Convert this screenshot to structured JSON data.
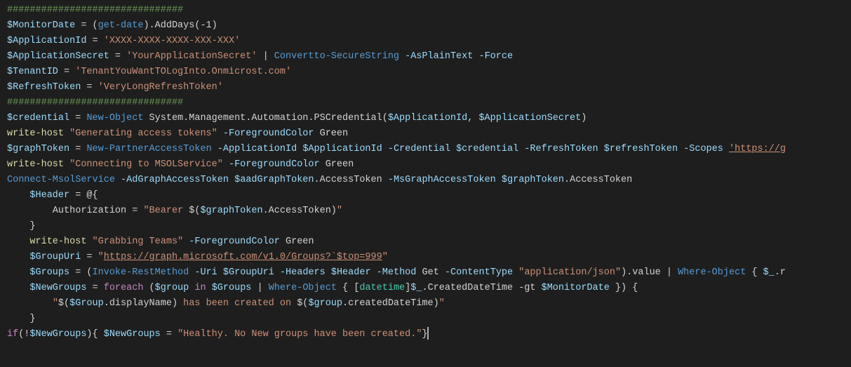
{
  "lines": [
    {
      "indent": 0,
      "tokens": [
        {
          "cls": "c-comment",
          "t": "###############################"
        }
      ]
    },
    {
      "indent": 0,
      "tokens": [
        {
          "cls": "c-var",
          "t": "$MonitorDate"
        },
        {
          "cls": "c-op",
          "t": " = ("
        },
        {
          "cls": "c-cmd",
          "t": "get-date"
        },
        {
          "cls": "c-op",
          "t": ").AddDays("
        },
        {
          "cls": "c-default",
          "t": "-1"
        },
        {
          "cls": "c-op",
          "t": ")"
        }
      ]
    },
    {
      "indent": 0,
      "tokens": [
        {
          "cls": "c-var",
          "t": "$ApplicationId"
        },
        {
          "cls": "c-op",
          "t": " = "
        },
        {
          "cls": "c-string",
          "t": "'XXXX-XXXX-XXXX-XXX-XXX'"
        }
      ]
    },
    {
      "indent": 0,
      "tokens": [
        {
          "cls": "c-var",
          "t": "$ApplicationSecret"
        },
        {
          "cls": "c-op",
          "t": " = "
        },
        {
          "cls": "c-string",
          "t": "'YourApplicationSecret'"
        },
        {
          "cls": "c-op",
          "t": " | "
        },
        {
          "cls": "c-cmd",
          "t": "Convertto-SecureString"
        },
        {
          "cls": "c-op",
          "t": " "
        },
        {
          "cls": "c-param",
          "t": "-AsPlainText"
        },
        {
          "cls": "c-op",
          "t": " "
        },
        {
          "cls": "c-param",
          "t": "-Force"
        }
      ]
    },
    {
      "indent": 0,
      "tokens": [
        {
          "cls": "c-var",
          "t": "$TenantID"
        },
        {
          "cls": "c-op",
          "t": " = "
        },
        {
          "cls": "c-string",
          "t": "'TenantYouWantTOLogInto.Onmicrost.com'"
        }
      ]
    },
    {
      "indent": 0,
      "tokens": [
        {
          "cls": "c-var",
          "t": "$RefreshToken"
        },
        {
          "cls": "c-op",
          "t": " = "
        },
        {
          "cls": "c-string",
          "t": "'VeryLongRefreshToken'"
        }
      ]
    },
    {
      "indent": 0,
      "tokens": [
        {
          "cls": "c-comment",
          "t": "###############################"
        }
      ]
    },
    {
      "indent": 0,
      "tokens": [
        {
          "cls": "c-var",
          "t": "$credential"
        },
        {
          "cls": "c-op",
          "t": " = "
        },
        {
          "cls": "c-cmd",
          "t": "New-Object"
        },
        {
          "cls": "c-op",
          "t": " System.Management.Automation.PSCredential("
        },
        {
          "cls": "c-var",
          "t": "$ApplicationId"
        },
        {
          "cls": "c-op",
          "t": ", "
        },
        {
          "cls": "c-var",
          "t": "$ApplicationSecret"
        },
        {
          "cls": "c-op",
          "t": ")"
        }
      ]
    },
    {
      "indent": 0,
      "tokens": [
        {
          "cls": "c-cmdlet",
          "t": "write-host"
        },
        {
          "cls": "c-op",
          "t": " "
        },
        {
          "cls": "c-string",
          "t": "\"Generating access tokens\""
        },
        {
          "cls": "c-op",
          "t": " "
        },
        {
          "cls": "c-param",
          "t": "-ForegroundColor"
        },
        {
          "cls": "c-op",
          "t": " Green"
        }
      ]
    },
    {
      "indent": 0,
      "tokens": [
        {
          "cls": "c-var",
          "t": "$graphToken"
        },
        {
          "cls": "c-op",
          "t": " = "
        },
        {
          "cls": "c-cmd",
          "t": "New-PartnerAccessToken"
        },
        {
          "cls": "c-op",
          "t": " "
        },
        {
          "cls": "c-param",
          "t": "-ApplicationId"
        },
        {
          "cls": "c-op",
          "t": " "
        },
        {
          "cls": "c-var",
          "t": "$ApplicationId"
        },
        {
          "cls": "c-op",
          "t": " "
        },
        {
          "cls": "c-param",
          "t": "-Credential"
        },
        {
          "cls": "c-op",
          "t": " "
        },
        {
          "cls": "c-var",
          "t": "$credential"
        },
        {
          "cls": "c-op",
          "t": " "
        },
        {
          "cls": "c-param",
          "t": "-RefreshToken"
        },
        {
          "cls": "c-op",
          "t": " "
        },
        {
          "cls": "c-var",
          "t": "$refreshToken"
        },
        {
          "cls": "c-op",
          "t": " "
        },
        {
          "cls": "c-param",
          "t": "-Scopes"
        },
        {
          "cls": "c-op",
          "t": " "
        },
        {
          "cls": "c-string-u",
          "t": "'https://g"
        }
      ]
    },
    {
      "indent": 0,
      "tokens": [
        {
          "cls": "c-cmdlet",
          "t": "write-host"
        },
        {
          "cls": "c-op",
          "t": " "
        },
        {
          "cls": "c-string",
          "t": "\"Connecting to MSOLService\""
        },
        {
          "cls": "c-op",
          "t": " "
        },
        {
          "cls": "c-param",
          "t": "-ForegroundColor"
        },
        {
          "cls": "c-op",
          "t": " Green"
        }
      ]
    },
    {
      "indent": 0,
      "tokens": [
        {
          "cls": "c-cmd",
          "t": "Connect-MsolService"
        },
        {
          "cls": "c-op",
          "t": " "
        },
        {
          "cls": "c-param",
          "t": "-AdGraphAccessToken"
        },
        {
          "cls": "c-op",
          "t": " "
        },
        {
          "cls": "c-var",
          "t": "$aadGraphToken"
        },
        {
          "cls": "c-op",
          "t": ".AccessToken "
        },
        {
          "cls": "c-param",
          "t": "-MsGraphAccessToken"
        },
        {
          "cls": "c-op",
          "t": " "
        },
        {
          "cls": "c-var",
          "t": "$graphToken"
        },
        {
          "cls": "c-op",
          "t": ".AccessToken"
        }
      ]
    },
    {
      "indent": 1,
      "tokens": [
        {
          "cls": "c-var",
          "t": "$Header"
        },
        {
          "cls": "c-op",
          "t": " = @{"
        }
      ]
    },
    {
      "indent": 2,
      "tokens": [
        {
          "cls": "c-default",
          "t": "Authorization = "
        },
        {
          "cls": "c-string",
          "t": "\"Bearer "
        },
        {
          "cls": "c-op",
          "t": "$("
        },
        {
          "cls": "c-var",
          "t": "$graphToken"
        },
        {
          "cls": "c-op",
          "t": ".AccessToken)"
        },
        {
          "cls": "c-string",
          "t": "\""
        }
      ]
    },
    {
      "indent": 1,
      "tokens": [
        {
          "cls": "c-op",
          "t": "}"
        }
      ]
    },
    {
      "indent": 1,
      "tokens": [
        {
          "cls": "c-cmdlet",
          "t": "write-host"
        },
        {
          "cls": "c-op",
          "t": " "
        },
        {
          "cls": "c-string",
          "t": "\"Grabbing Teams\""
        },
        {
          "cls": "c-op",
          "t": " "
        },
        {
          "cls": "c-param",
          "t": "-ForegroundColor"
        },
        {
          "cls": "c-op",
          "t": " Green"
        }
      ]
    },
    {
      "indent": 1,
      "tokens": [
        {
          "cls": "c-var",
          "t": "$GroupUri"
        },
        {
          "cls": "c-op",
          "t": " = "
        },
        {
          "cls": "c-string",
          "t": "\""
        },
        {
          "cls": "c-string-u",
          "t": "https://graph.microsoft.com/v1.0/Groups?`$top=999"
        },
        {
          "cls": "c-string",
          "t": "\""
        }
      ]
    },
    {
      "indent": 1,
      "tokens": [
        {
          "cls": "c-var",
          "t": "$Groups"
        },
        {
          "cls": "c-op",
          "t": " = ("
        },
        {
          "cls": "c-cmd",
          "t": "Invoke-RestMethod"
        },
        {
          "cls": "c-op",
          "t": " "
        },
        {
          "cls": "c-param",
          "t": "-Uri"
        },
        {
          "cls": "c-op",
          "t": " "
        },
        {
          "cls": "c-var",
          "t": "$GroupUri"
        },
        {
          "cls": "c-op",
          "t": " "
        },
        {
          "cls": "c-param",
          "t": "-Headers"
        },
        {
          "cls": "c-op",
          "t": " "
        },
        {
          "cls": "c-var",
          "t": "$Header"
        },
        {
          "cls": "c-op",
          "t": " "
        },
        {
          "cls": "c-param",
          "t": "-Method"
        },
        {
          "cls": "c-op",
          "t": " Get "
        },
        {
          "cls": "c-param",
          "t": "-ContentType"
        },
        {
          "cls": "c-op",
          "t": " "
        },
        {
          "cls": "c-string",
          "t": "\"application/json\""
        },
        {
          "cls": "c-op",
          "t": ").value | "
        },
        {
          "cls": "c-cmd",
          "t": "Where-Object"
        },
        {
          "cls": "c-op",
          "t": " { "
        },
        {
          "cls": "c-var",
          "t": "$_"
        },
        {
          "cls": "c-op",
          "t": ".r"
        }
      ]
    },
    {
      "indent": 1,
      "tokens": [
        {
          "cls": "c-var",
          "t": "$NewGroups"
        },
        {
          "cls": "c-op",
          "t": " = "
        },
        {
          "cls": "c-kw",
          "t": "foreach"
        },
        {
          "cls": "c-op",
          "t": " ("
        },
        {
          "cls": "c-var",
          "t": "$group"
        },
        {
          "cls": "c-op",
          "t": " "
        },
        {
          "cls": "c-kw",
          "t": "in"
        },
        {
          "cls": "c-op",
          "t": " "
        },
        {
          "cls": "c-var",
          "t": "$Groups"
        },
        {
          "cls": "c-op",
          "t": " | "
        },
        {
          "cls": "c-cmd",
          "t": "Where-Object"
        },
        {
          "cls": "c-op",
          "t": " { ["
        },
        {
          "cls": "c-type",
          "t": "datetime"
        },
        {
          "cls": "c-op",
          "t": "]"
        },
        {
          "cls": "c-var",
          "t": "$_"
        },
        {
          "cls": "c-op",
          "t": ".CreatedDateTime "
        },
        {
          "cls": "c-op",
          "t": "-gt "
        },
        {
          "cls": "c-var",
          "t": "$MonitorDate"
        },
        {
          "cls": "c-op",
          "t": " }) {"
        }
      ]
    },
    {
      "indent": 2,
      "tokens": [
        {
          "cls": "c-string",
          "t": "\""
        },
        {
          "cls": "c-op",
          "t": "$("
        },
        {
          "cls": "c-var",
          "t": "$Group"
        },
        {
          "cls": "c-op",
          "t": ".displayName)"
        },
        {
          "cls": "c-string",
          "t": " has been created on "
        },
        {
          "cls": "c-op",
          "t": "$("
        },
        {
          "cls": "c-var",
          "t": "$group"
        },
        {
          "cls": "c-op",
          "t": ".createdDateTime)"
        },
        {
          "cls": "c-string",
          "t": "\""
        }
      ]
    },
    {
      "indent": 0,
      "tokens": [
        {
          "cls": "c-default",
          "t": ""
        }
      ]
    },
    {
      "indent": 1,
      "tokens": [
        {
          "cls": "c-op",
          "t": "}"
        }
      ]
    },
    {
      "indent": 0,
      "tokens": [
        {
          "cls": "c-kw",
          "t": "if"
        },
        {
          "cls": "c-op",
          "t": "(!"
        },
        {
          "cls": "c-var",
          "t": "$NewGroups"
        },
        {
          "cls": "c-op",
          "t": "){ "
        },
        {
          "cls": "c-var",
          "t": "$NewGroups"
        },
        {
          "cls": "c-op",
          "t": " = "
        },
        {
          "cls": "c-string",
          "t": "\"Healthy. No New groups have been created.\""
        },
        {
          "cls": "c-op",
          "t": "}"
        }
      ]
    }
  ],
  "indentUnit": "    ",
  "cursorLine": 22
}
